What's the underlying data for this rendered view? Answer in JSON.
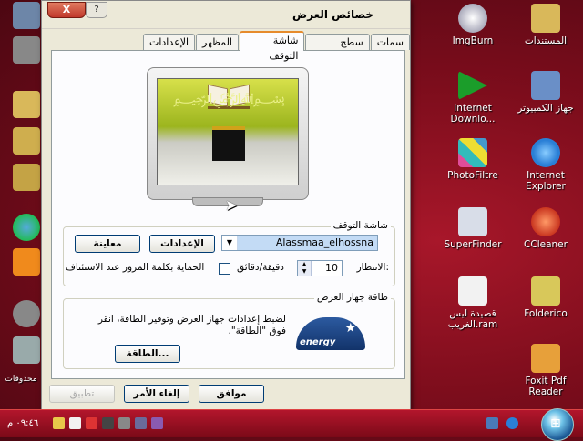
{
  "dialog": {
    "title": "خصائص العرض",
    "close_label": "X",
    "help_label": "?",
    "tabs": [
      {
        "label": "سمات"
      },
      {
        "label": "سطح المكتب"
      },
      {
        "label": "شاشة التوقف"
      },
      {
        "label": "المظهر"
      },
      {
        "label": "الإعدادات"
      }
    ],
    "screensaver": {
      "group_title": "شاشة التوقف",
      "selected": "Alassmaa_elhossna",
      "settings_button": "الإعدادات",
      "preview_button": "معاينة",
      "wait_label": "الانتظار:",
      "wait_value": "10",
      "minutes_label": "دقيقة/دقائق",
      "password_label": "الحماية بكلمة المرور عند الاستئناف"
    },
    "power": {
      "group_title": "طاقة جهاز العرض",
      "description": "لضبط إعدادات جهاز العرض وتوفير الطاقة، انقر فوق \"الطاقة\".",
      "power_button": "الطاقة...",
      "logo_text": "energy",
      "star_glyph": "★"
    },
    "ok_button": "موافق",
    "cancel_button": "إلغاء الأمر",
    "apply_button": "تطبيق"
  },
  "desktop_icons": [
    {
      "label": "المستندات",
      "color": "#d9b85a"
    },
    {
      "label": "ImgBurn",
      "color": "#e8e8f0"
    },
    {
      "label": "جهاز الكمبيوتر",
      "color": "#6a8fc7"
    },
    {
      "label": "Internet Downlo...",
      "color": "#1b9d2a"
    },
    {
      "label": "PhotoFiltre",
      "color": "#e04d9a"
    },
    {
      "label": "Internet Explorer",
      "color": "#2a7fd6"
    },
    {
      "label": "SuperFinder",
      "color": "#d8dde8"
    },
    {
      "label": "CCleaner",
      "color": "#c9351f"
    },
    {
      "label": "قصيدة ليس الغريب.ram",
      "color": "#f2f2f2"
    },
    {
      "label": "Folderico",
      "color": "#d8c85a"
    },
    {
      "label": "Foxit Pdf Reader",
      "color": "#e7a03a"
    }
  ],
  "left_caption": "محذوفات",
  "taskbar": {
    "clock": "٠٩:٤٦ م"
  }
}
